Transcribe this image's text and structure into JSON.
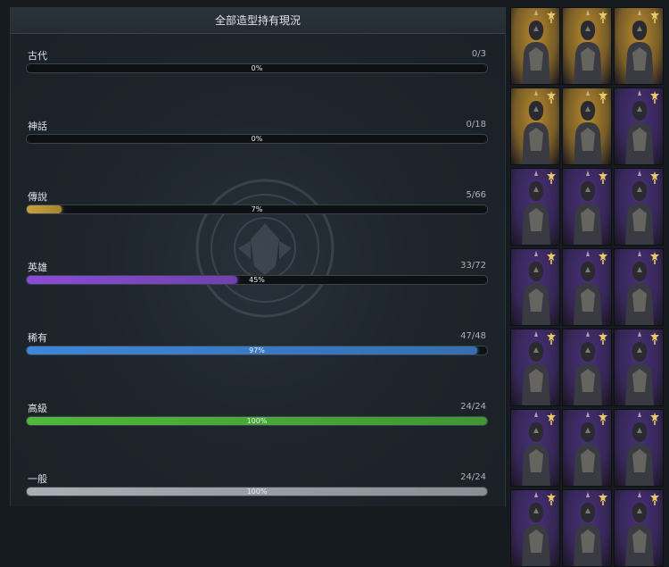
{
  "panel": {
    "title": "全部造型持有現況",
    "rows": [
      {
        "label": "古代",
        "count": "0/3",
        "percent": "0%",
        "fraction": 0.0,
        "color": "#c9a23c"
      },
      {
        "label": "神話",
        "count": "0/18",
        "percent": "0%",
        "fraction": 0.0,
        "color": "#d14a3a"
      },
      {
        "label": "傳說",
        "count": "5/66",
        "percent": "7%",
        "fraction": 0.076,
        "color": "#c9a23c"
      },
      {
        "label": "英雄",
        "count": "33/72",
        "percent": "45%",
        "fraction": 0.458,
        "color": "#8a4cd6"
      },
      {
        "label": "稀有",
        "count": "47/48",
        "percent": "97%",
        "fraction": 0.979,
        "color": "#3f86d8"
      },
      {
        "label": "高級",
        "count": "24/24",
        "percent": "100%",
        "fraction": 1.0,
        "color": "#4fb83a"
      },
      {
        "label": "一般",
        "count": "24/24",
        "percent": "100%",
        "fraction": 1.0,
        "color": "#a8aeb4"
      }
    ]
  },
  "portraits": {
    "tiers": {
      "gold": "#b8892c",
      "purple": "#4a2f7a"
    },
    "rows": [
      [
        "gold",
        "gold",
        "gold"
      ],
      [
        "gold",
        "gold",
        "purple"
      ],
      [
        "purple",
        "purple",
        "purple"
      ],
      [
        "purple",
        "purple",
        "purple"
      ],
      [
        "purple",
        "purple",
        "purple"
      ],
      [
        "purple",
        "purple",
        "purple"
      ],
      [
        "purple",
        "purple",
        "purple"
      ]
    ]
  }
}
